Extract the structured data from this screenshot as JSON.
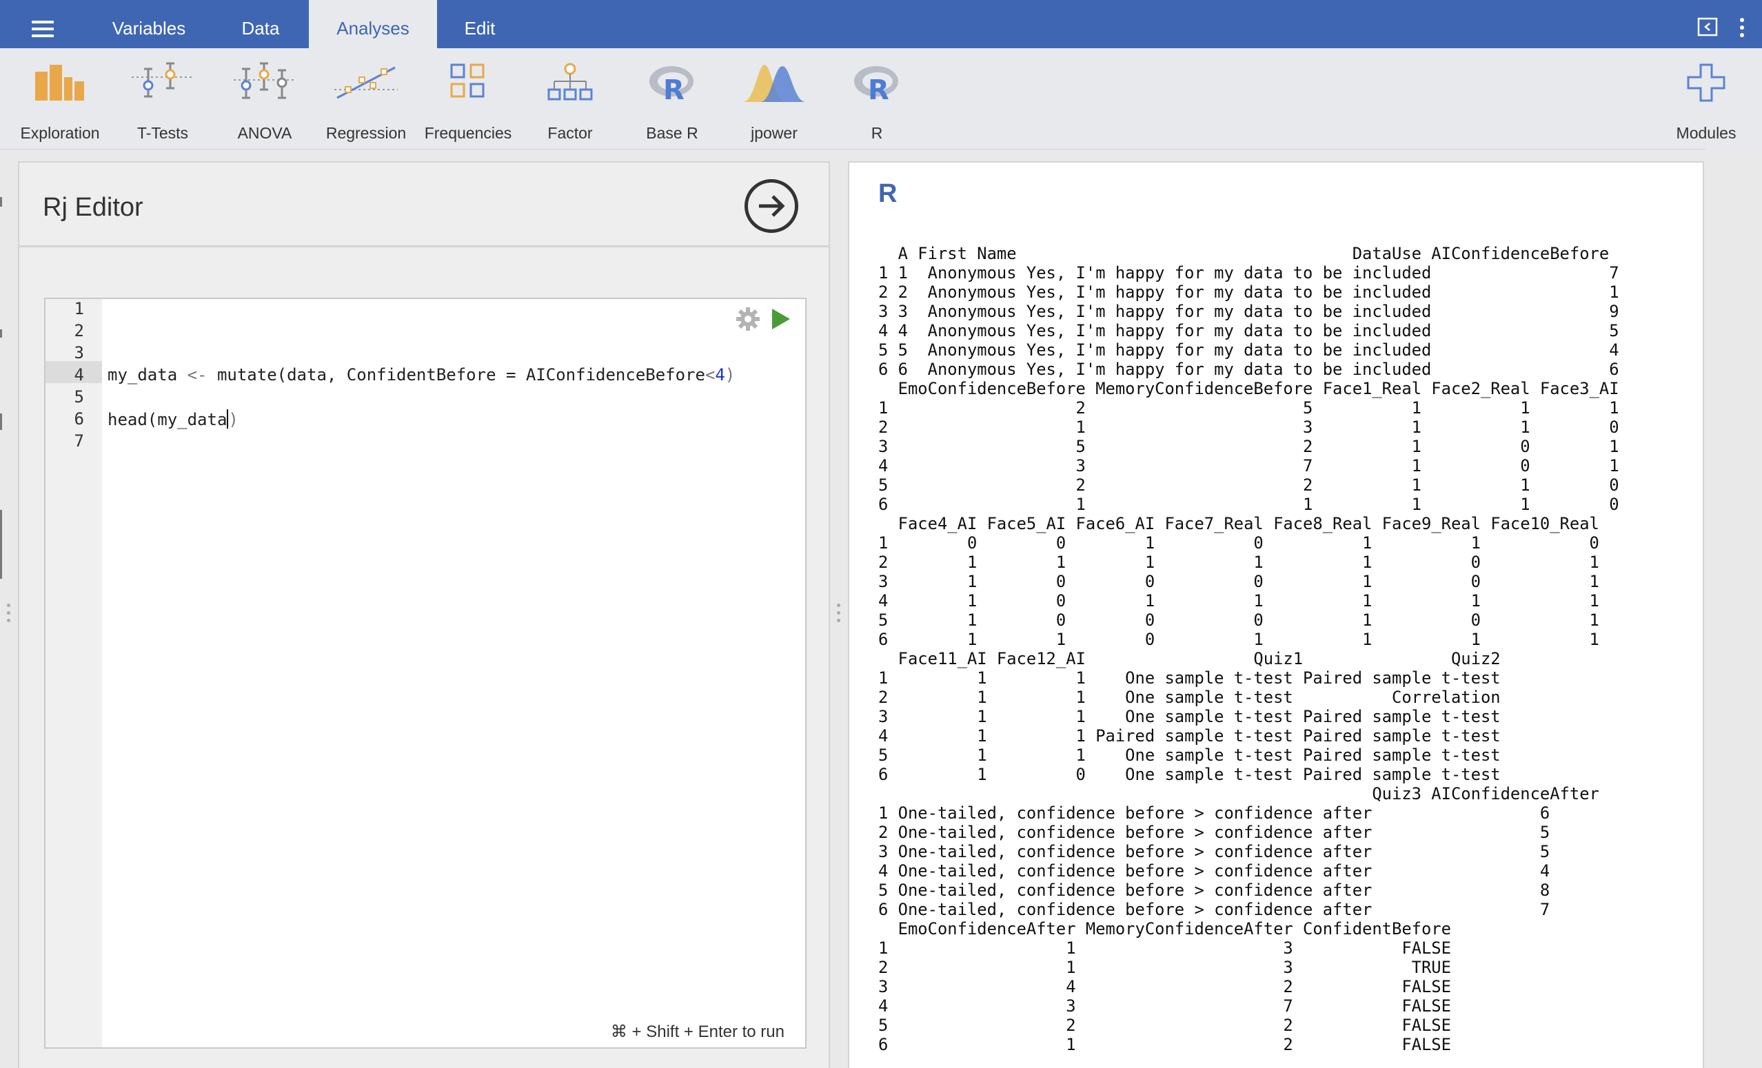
{
  "menu": {
    "tabs": [
      {
        "label": "Variables"
      },
      {
        "label": "Data"
      },
      {
        "label": "Analyses",
        "active": true
      },
      {
        "label": "Edit"
      }
    ]
  },
  "ribbon": {
    "items": [
      {
        "label": "Exploration",
        "icon": "exploration-bars-icon"
      },
      {
        "label": "T-Tests",
        "icon": "t-tests-icon"
      },
      {
        "label": "ANOVA",
        "icon": "anova-icon"
      },
      {
        "label": "Regression",
        "icon": "regression-icon"
      },
      {
        "label": "Frequencies",
        "icon": "frequencies-icon"
      },
      {
        "label": "Factor",
        "icon": "factor-icon"
      },
      {
        "label": "Base R",
        "icon": "r-logo-icon"
      },
      {
        "label": "jpower",
        "icon": "jpower-curve-icon"
      },
      {
        "label": "R",
        "icon": "r-logo-icon"
      }
    ],
    "modules_label": "Modules"
  },
  "editor": {
    "title": "Rj Editor",
    "line_numbers": [
      "1",
      "2",
      "3",
      "4",
      "5",
      "6",
      "7"
    ],
    "active_line": "6",
    "line4": {
      "a": "my_data ",
      "op": "<-",
      "b": " mutate(data, ConfidentBefore = AIConfidenceBefore",
      "lt": "<",
      "num": "4",
      "close": ")"
    },
    "line6": {
      "a": "head(my_data",
      "close": ")"
    },
    "run_hint": "⌘ + Shift + Enter to run"
  },
  "results": {
    "heading": "R",
    "output": "  A First Name                                  DataUse AIConfidenceBefore\n1 1  Anonymous Yes, I'm happy for my data to be included                  7\n2 2  Anonymous Yes, I'm happy for my data to be included                  1\n3 3  Anonymous Yes, I'm happy for my data to be included                  9\n4 4  Anonymous Yes, I'm happy for my data to be included                  5\n5 5  Anonymous Yes, I'm happy for my data to be included                  4\n6 6  Anonymous Yes, I'm happy for my data to be included                  6\n  EmoConfidenceBefore MemoryConfidenceBefore Face1_Real Face2_Real Face3_AI\n1                   2                      5          1          1        1\n2                   1                      3          1          1        0\n3                   5                      2          1          0        1\n4                   3                      7          1          0        1\n5                   2                      2          1          1        0\n6                   1                      1          1          1        0\n  Face4_AI Face5_AI Face6_AI Face7_Real Face8_Real Face9_Real Face10_Real\n1        0        0        1          0          1          1           0\n2        1        1        1          1          1          0           1\n3        1        0        0          0          1          0           1\n4        1        0        1          1          1          1           1\n5        1        0        0          0          1          0           1\n6        1        1        0          1          1          1           1\n  Face11_AI Face12_AI                 Quiz1               Quiz2\n1         1         1    One sample t-test Paired sample t-test\n2         1         1    One sample t-test          Correlation\n3         1         1    One sample t-test Paired sample t-test\n4         1         1 Paired sample t-test Paired sample t-test\n5         1         1    One sample t-test Paired sample t-test\n6         1         0    One sample t-test Paired sample t-test\n                                                  Quiz3 AIConfidenceAfter\n1 One-tailed, confidence before > confidence after                 6\n2 One-tailed, confidence before > confidence after                 5\n3 One-tailed, confidence before > confidence after                 5\n4 One-tailed, confidence before > confidence after                 4\n5 One-tailed, confidence before > confidence after                 8\n6 One-tailed, confidence before > confidence after                 7\n  EmoConfidenceAfter MemoryConfidenceAfter ConfidentBefore\n1                  1                     3           FALSE\n2                  1                     3            TRUE\n3                  4                     2           FALSE\n4                  3                     7           FALSE\n5                  2                     2           FALSE\n6                  1                     2           FALSE"
  },
  "colors": {
    "brand_blue": "#3f66b3",
    "ribbon_orange": "#e8a84a",
    "ribbon_blue": "#5b82d4",
    "run_green": "#4a9a3a"
  }
}
